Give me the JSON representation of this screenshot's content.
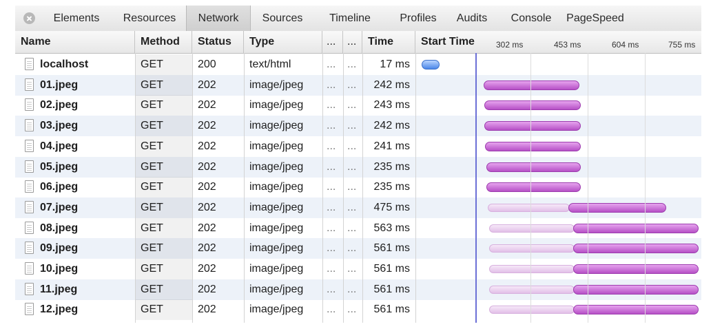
{
  "tabs": [
    {
      "label": "Elements"
    },
    {
      "label": "Resources"
    },
    {
      "label": "Network"
    },
    {
      "label": "Sources"
    },
    {
      "label": "Timeline"
    },
    {
      "label": "Profiles"
    },
    {
      "label": "Audits"
    },
    {
      "label": "Console"
    },
    {
      "label": "PageSpeed"
    }
  ],
  "active_tab": "Network",
  "columns": {
    "name": "Name",
    "method": "Method",
    "status": "Status",
    "type": "Type",
    "col5": "...",
    "col6": "...",
    "time": "Time",
    "start_time": "Start Time"
  },
  "timeline_ticks": [
    "302 ms",
    "453 ms",
    "604 ms",
    "755 ms"
  ],
  "rows": [
    {
      "name": "localhost",
      "method": "GET",
      "status": "200",
      "type": "text/html",
      "c5": "...",
      "c6": "...",
      "time": "17 ms"
    },
    {
      "name": "01.jpeg",
      "method": "GET",
      "status": "202",
      "type": "image/jpeg",
      "c5": "...",
      "c6": "...",
      "time": "242 ms"
    },
    {
      "name": "02.jpeg",
      "method": "GET",
      "status": "202",
      "type": "image/jpeg",
      "c5": "...",
      "c6": "...",
      "time": "243 ms"
    },
    {
      "name": "03.jpeg",
      "method": "GET",
      "status": "202",
      "type": "image/jpeg",
      "c5": "...",
      "c6": "...",
      "time": "242 ms"
    },
    {
      "name": "04.jpeg",
      "method": "GET",
      "status": "202",
      "type": "image/jpeg",
      "c5": "...",
      "c6": "...",
      "time": "241 ms"
    },
    {
      "name": "05.jpeg",
      "method": "GET",
      "status": "202",
      "type": "image/jpeg",
      "c5": "...",
      "c6": "...",
      "time": "235 ms"
    },
    {
      "name": "06.jpeg",
      "method": "GET",
      "status": "202",
      "type": "image/jpeg",
      "c5": "...",
      "c6": "...",
      "time": "235 ms"
    },
    {
      "name": "07.jpeg",
      "method": "GET",
      "status": "202",
      "type": "image/jpeg",
      "c5": "...",
      "c6": "...",
      "time": "475 ms"
    },
    {
      "name": "08.jpeg",
      "method": "GET",
      "status": "202",
      "type": "image/jpeg",
      "c5": "...",
      "c6": "...",
      "time": "563 ms"
    },
    {
      "name": "09.jpeg",
      "method": "GET",
      "status": "202",
      "type": "image/jpeg",
      "c5": "...",
      "c6": "...",
      "time": "561 ms"
    },
    {
      "name": "10.jpeg",
      "method": "GET",
      "status": "202",
      "type": "image/jpeg",
      "c5": "...",
      "c6": "...",
      "time": "561 ms"
    },
    {
      "name": "11.jpeg",
      "method": "GET",
      "status": "202",
      "type": "image/jpeg",
      "c5": "...",
      "c6": "...",
      "time": "561 ms"
    },
    {
      "name": "12.jpeg",
      "method": "GET",
      "status": "202",
      "type": "image/jpeg",
      "c5": "...",
      "c6": "...",
      "time": "561 ms"
    }
  ],
  "colors": {
    "start_line": "#6b6fd6",
    "receive_bar": "#b650c6",
    "wait_bar": "#e2c0e8",
    "document_bar": "#4a86e8",
    "stripe": "#edf2f9"
  }
}
